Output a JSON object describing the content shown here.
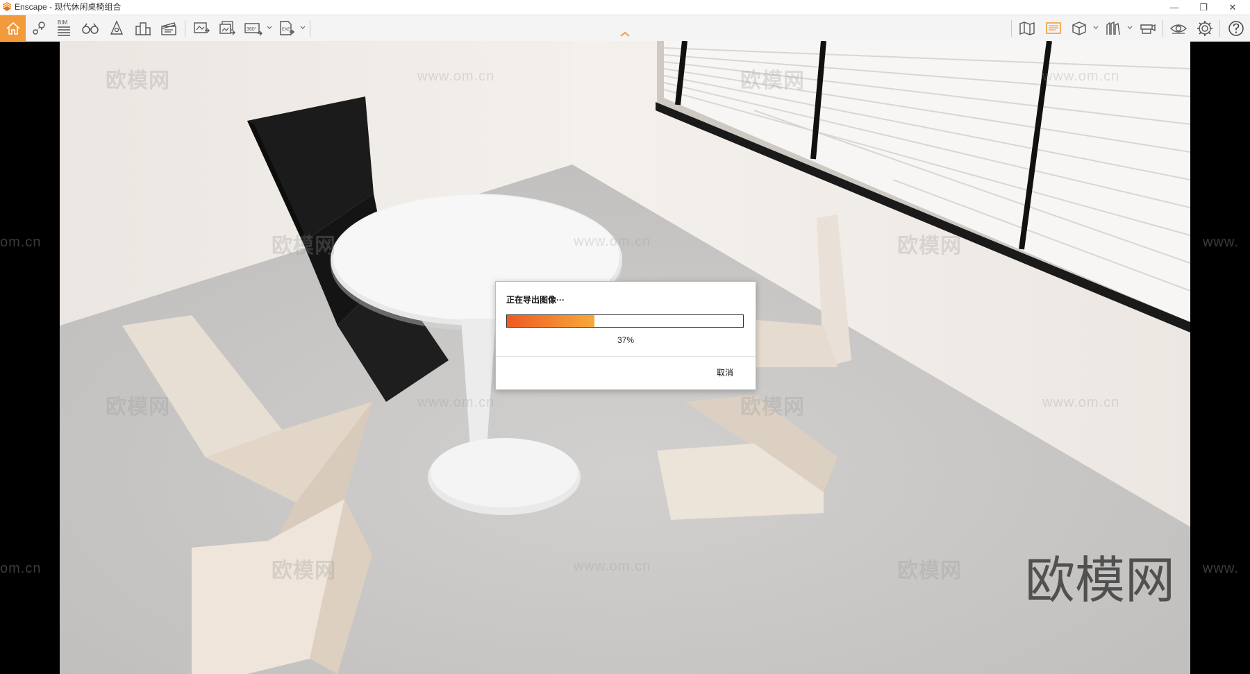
{
  "window": {
    "app_name": "Enscape",
    "title": "Enscape - 现代休闲桌椅组合",
    "controls": {
      "minimize": "—",
      "restore": "❐",
      "close": "✕"
    }
  },
  "toolbar": {
    "left_icons": [
      "home-icon",
      "gps-icon",
      "bim-icon",
      "binoculars-icon",
      "pen-icon",
      "buildings-icon",
      "clapperboard-icon",
      "screenshot-icon",
      "batch-render-icon",
      "panorama-360-icon",
      "exe-export-icon"
    ],
    "bim_label": "BIM",
    "pano_label": "360°",
    "exe_label": "EXE",
    "right_icons": [
      "map-icon",
      "window-icon",
      "cube-icon",
      "library-icon",
      "asset-icon",
      "eye-icon",
      "gear-icon",
      "help-icon"
    ],
    "accent_color": "#f39a3c"
  },
  "viewport": {
    "watermark_brand": "欧模网",
    "watermark_url": "www.om.cn",
    "watermark_url_partial": "om.cn",
    "watermark_url_edge": "www.",
    "big_watermark": "欧模网"
  },
  "dialog": {
    "title": "正在导出图像···",
    "progress": 0.37,
    "progress_label": "37%",
    "cancel_label": "取消",
    "fill_start_color": "#ee5a22",
    "fill_end_color": "#f7a93a"
  }
}
